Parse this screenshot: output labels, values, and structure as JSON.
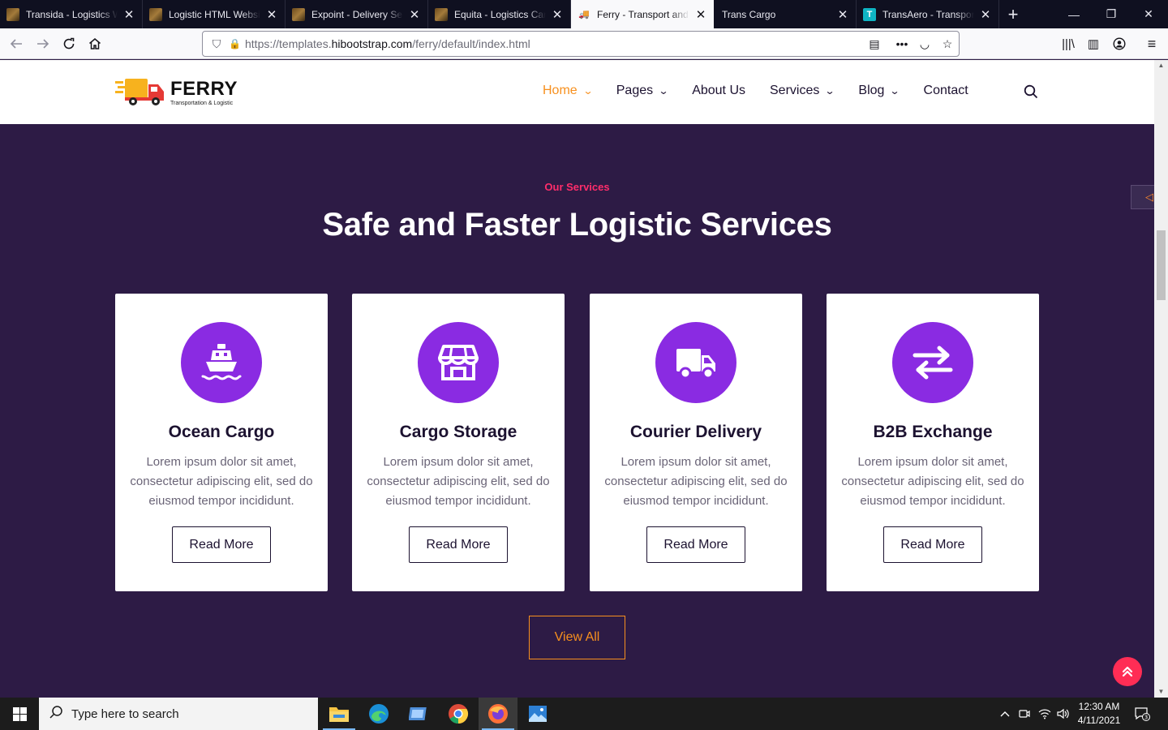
{
  "browser": {
    "tabs": [
      {
        "title": "Transida - Logistics W",
        "favicon": "book-icon",
        "active": false
      },
      {
        "title": "Logistic HTML Websit",
        "favicon": "book-icon",
        "active": false
      },
      {
        "title": "Expoint - Delivery Ser",
        "favicon": "book-icon",
        "active": false
      },
      {
        "title": "Equita - Logistics Carg",
        "favicon": "book-icon",
        "active": false
      },
      {
        "title": "Ferry - Transport and L",
        "favicon": "truck-icon",
        "active": true
      },
      {
        "title": "Trans Cargo",
        "favicon": "none",
        "active": false
      },
      {
        "title": "TransAero - Transport",
        "favicon": "t-icon",
        "active": false
      }
    ],
    "url_prefix": "https://templates.",
    "url_domain": "hibootstrap.com",
    "url_path": "/ferry/default/index.html"
  },
  "site": {
    "logo_word": "FERRY",
    "logo_tagline": "Transportation & Logistic",
    "menu": [
      {
        "label": "Home",
        "dropdown": true,
        "active": true
      },
      {
        "label": "Pages",
        "dropdown": true,
        "active": false
      },
      {
        "label": "About Us",
        "dropdown": false,
        "active": false
      },
      {
        "label": "Services",
        "dropdown": true,
        "active": false
      },
      {
        "label": "Blog",
        "dropdown": true,
        "active": false
      },
      {
        "label": "Contact",
        "dropdown": false,
        "active": false
      }
    ],
    "colors": {
      "accent": "#f7901e",
      "purple": "#8a2be2",
      "pink": "#ff2d6b",
      "section_bg": "#2d1b45"
    }
  },
  "services": {
    "eyebrow": "Our Services",
    "heading": "Safe and Faster Logistic Services",
    "cards": [
      {
        "title": "Ocean Cargo",
        "icon": "ship-icon",
        "desc": "Lorem ipsum dolor sit amet, consectetur adipiscing elit, sed do eiusmod tempor incididunt.",
        "button": "Read More"
      },
      {
        "title": "Cargo Storage",
        "icon": "storefront-icon",
        "desc": "Lorem ipsum dolor sit amet, consectetur adipiscing elit, sed do eiusmod tempor incididunt.",
        "button": "Read More"
      },
      {
        "title": "Courier Delivery",
        "icon": "truck-icon",
        "desc": "Lorem ipsum dolor sit amet, consectetur adipiscing elit, sed do eiusmod tempor incididunt.",
        "button": "Read More"
      },
      {
        "title": "B2B Exchange",
        "icon": "exchange-arrows-icon",
        "desc": "Lorem ipsum dolor sit amet, consectetur adipiscing elit, sed do eiusmod tempor incididunt.",
        "button": "Read More"
      }
    ],
    "view_all": "View All"
  },
  "taskbar": {
    "search_placeholder": "Type here to search",
    "time": "12:30 AM",
    "date": "4/11/2021",
    "notifications": "3"
  }
}
